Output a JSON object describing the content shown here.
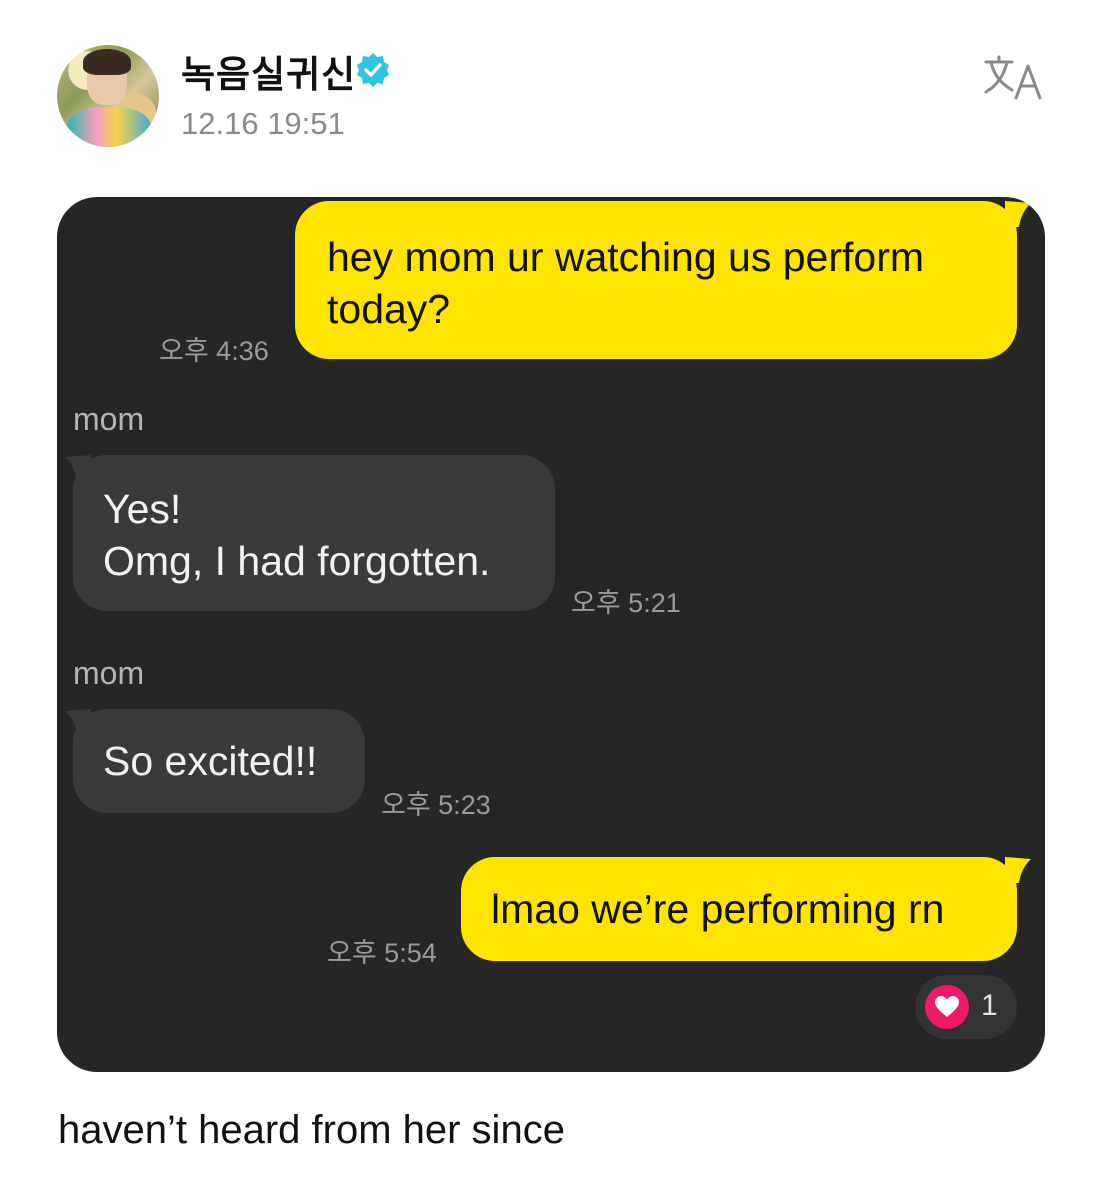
{
  "post": {
    "username": "녹음실귀신",
    "timestamp": "12.16 19:51",
    "verified_icon": "verified-badge-icon",
    "translate_icon": "translate-icon",
    "caption": "haven’t heard from her since"
  },
  "chat": {
    "messages": [
      {
        "direction": "outgoing",
        "lines": [
          "hey mom ur watching us perform",
          "today?"
        ],
        "time": "오후 4:36"
      },
      {
        "direction": "incoming",
        "sender": "mom",
        "lines": [
          "Yes!",
          "Omg, I had forgotten."
        ],
        "time": "오후 5:21"
      },
      {
        "direction": "incoming",
        "sender": "mom",
        "lines": [
          "So excited!!"
        ],
        "time": "오후 5:23"
      },
      {
        "direction": "outgoing",
        "lines": [
          "lmao we’re performing rn"
        ],
        "time": "오후 5:54"
      }
    ],
    "reaction": {
      "icon": "heart-icon",
      "count": "1"
    }
  },
  "colors": {
    "outgoing_bubble": "#fee500",
    "incoming_bubble": "#3a3a3c",
    "chat_background": "#262626",
    "verified": "#2fc4dd",
    "heart": "#f0196a"
  }
}
